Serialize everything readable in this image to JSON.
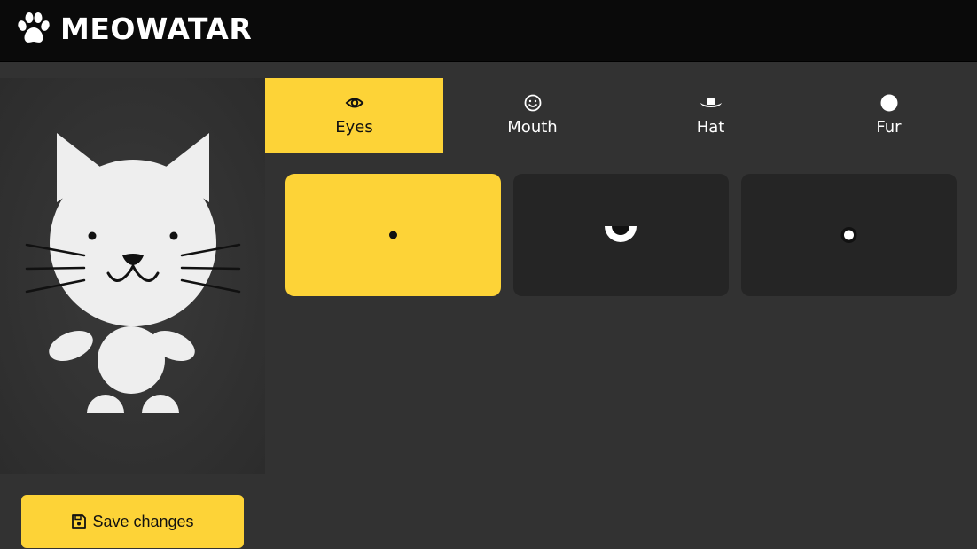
{
  "app": {
    "title": "MEOWATAR",
    "logo_icon": "paw-icon"
  },
  "save_button": {
    "label": "Save changes",
    "icon": "floppy-disk-icon"
  },
  "tabs": [
    {
      "label": "Eyes",
      "icon": "eye-icon",
      "active": true
    },
    {
      "label": "Mouth",
      "icon": "smiley-icon",
      "active": false
    },
    {
      "label": "Hat",
      "icon": "cowboy-hat-icon",
      "active": false
    },
    {
      "label": "Fur",
      "icon": "circle-icon",
      "active": false
    }
  ],
  "eye_options": [
    {
      "style": "small-dot",
      "selected": true
    },
    {
      "style": "half-moon",
      "selected": false
    },
    {
      "style": "ringed-dot",
      "selected": false
    }
  ],
  "colors": {
    "accent": "#fdd337",
    "background": "#323232",
    "topbar": "#0a0a0a",
    "card": "#252525",
    "cat_body": "#eeeeee"
  }
}
